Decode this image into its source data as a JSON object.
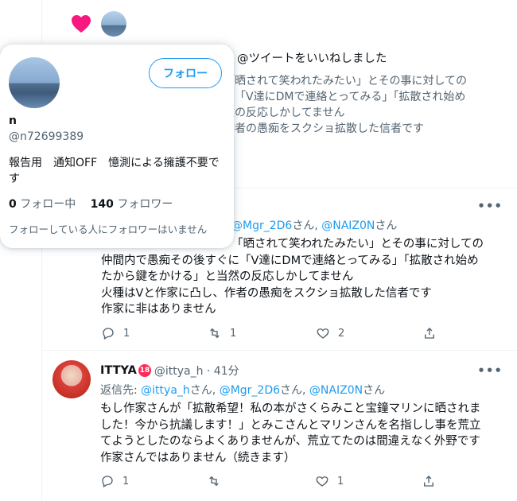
{
  "notification": {
    "text": "@ツイートをいいねしました",
    "quote_lines": [
      "「晒されて笑われたみたい」とその事に対しての",
      "に「V達にDMで連絡とってみる」「拡散され始め",
      "然の反応しかしてません",
      "作者の愚痴をスクショ拡散した信者です"
    ]
  },
  "tweet1": {
    "more": "•••",
    "reply_visible": [
      {
        "text": "@Mgr_2D6",
        "kind": "mention"
      },
      {
        "text": "さん, ",
        "kind": "plain"
      },
      {
        "text": "@NAIZ0N",
        "kind": "mention"
      },
      {
        "text": "さん",
        "kind": "plain"
      }
    ],
    "body_lines": [
      "「晒されて笑われたみたい」とその事に対しての",
      "仲間内で愚痴その後すぐに「V達にDMで連絡とってみる」「拡散され始め",
      "たから鍵をかける」と当然の反応しかしてません",
      "火種はVと作家に凸し、作者の愚痴をスクショ拡散した信者です",
      "作家に非はありません"
    ],
    "actions": {
      "reply": "1",
      "retweet": "1",
      "like": "2",
      "share": ""
    }
  },
  "tweet2": {
    "name": "ITTYA",
    "badge": "18",
    "handle": "@ittya_h · 41分",
    "more": "•••",
    "reply_prefix": "返信先: ",
    "reply_mentions": [
      {
        "text": "@ittya_h",
        "kind": "mention"
      },
      {
        "text": "さん, ",
        "kind": "plain"
      },
      {
        "text": "@Mgr_2D6",
        "kind": "mention"
      },
      {
        "text": "さん, ",
        "kind": "plain"
      },
      {
        "text": "@NAIZ0N",
        "kind": "mention"
      },
      {
        "text": "さん",
        "kind": "plain"
      }
    ],
    "body_lines": [
      "もし作家さんが「拡散希望！私の本がさくらみこと宝鐘マリンに晒されま",
      "した！今から抗議します！」とみこさんとマリンさんを名指しし事を荒立",
      "てようとしたのならよくありませんが、荒立てたのは間違えなく外野です",
      "作家さんではありません（続きます）"
    ],
    "actions": {
      "reply": "1",
      "retweet": "",
      "like": "1",
      "share": ""
    }
  },
  "popover": {
    "name": "n",
    "handle": "@n72699389",
    "follow_label": "フォロー",
    "bio": "報告用　通知OFF　憶測による擁護不要です",
    "following_count": "0",
    "following_label": " フォロー中　",
    "followers_count": "140",
    "followers_label": " フォロワー",
    "note": "フォローしている人にフォロワーはいません"
  },
  "colors": {
    "accent": "#1d9bf0",
    "heart": "#f91880",
    "muted": "#536471"
  }
}
